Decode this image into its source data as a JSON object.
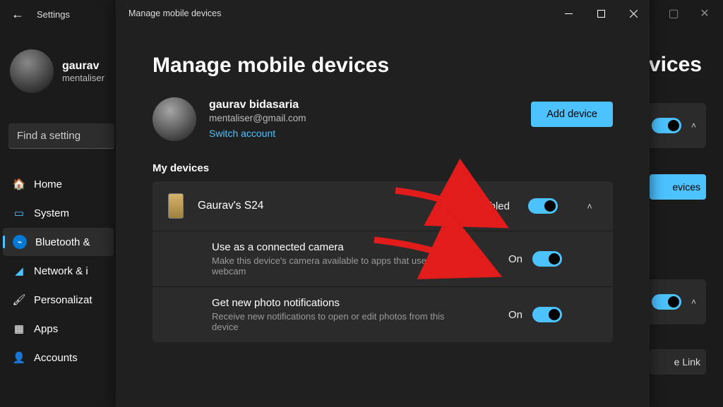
{
  "background": {
    "titlebar_label": "Settings",
    "user_name": "gaurav",
    "user_email": "mentaliser",
    "search_placeholder": "Find a setting",
    "nav": [
      {
        "label": "Home",
        "icon": "🏠"
      },
      {
        "label": "System",
        "icon": "💻"
      },
      {
        "label": "Bluetooth &",
        "icon": "bt",
        "active": true
      },
      {
        "label": "Network & i",
        "icon": "📶"
      },
      {
        "label": "Personalizat",
        "icon": "🖌️"
      },
      {
        "label": "Apps",
        "icon": "▦"
      },
      {
        "label": "Accounts",
        "icon": "👤"
      }
    ],
    "right_heading": "devices",
    "right_button_1": "evices",
    "right_button_2": "e Link"
  },
  "dialog": {
    "titlebar": "Manage mobile devices",
    "page_title": "Manage mobile devices",
    "account": {
      "name": "gaurav bidasaria",
      "email": "mentaliser@gmail.com",
      "switch_label": "Switch account"
    },
    "add_device_label": "Add device",
    "devices_section_label": "My devices",
    "device": {
      "name": "Gaurav's S24",
      "state_label": "Enabled",
      "options": [
        {
          "title": "Use as a connected camera",
          "desc": "Make this device's camera available to apps that use a webcam",
          "state": "On"
        },
        {
          "title": "Get new photo notifications",
          "desc": "Receive new notifications to open or edit photos from this device",
          "state": "On"
        }
      ]
    }
  }
}
